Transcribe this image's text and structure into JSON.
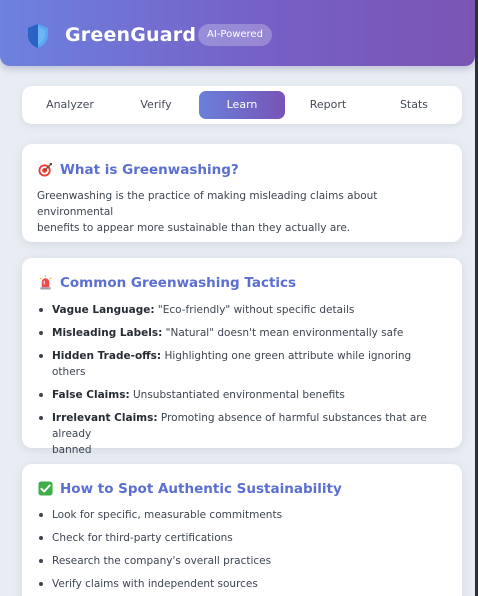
{
  "app": {
    "name": "GreenGuard",
    "badge": "AI-Powered",
    "logo_icon": "shield-icon"
  },
  "tabs": [
    {
      "label": "Analyzer",
      "active": false
    },
    {
      "label": "Verify",
      "active": false
    },
    {
      "label": "Learn",
      "active": true
    },
    {
      "label": "Report",
      "active": false
    },
    {
      "label": "Stats",
      "active": false
    }
  ],
  "sections": {
    "what": {
      "icon": "target-icon",
      "title": "What is Greenwashing?",
      "text_line1": "Greenwashing is the practice of making misleading claims about environmental",
      "text_line2": "benefits to appear more sustainable than they actually are."
    },
    "tactics": {
      "icon": "siren-icon",
      "title": "Common Greenwashing Tactics",
      "items": [
        {
          "term": "Vague Language:",
          "desc": " \"Eco-friendly\" without specific details"
        },
        {
          "term": "Misleading Labels:",
          "desc": " \"Natural\" doesn't mean environmentally safe"
        },
        {
          "term": "Hidden Trade-offs:",
          "desc": " Highlighting one green attribute while ignoring others"
        },
        {
          "term": "False Claims:",
          "desc": " Unsubstantiated environmental benefits"
        },
        {
          "term": "Irrelevant Claims:",
          "desc": " Promoting absence of harmful substances that are already",
          "desc2": "banned"
        }
      ]
    },
    "spot": {
      "icon": "check-mark-icon",
      "title": "How to Spot Authentic Sustainability",
      "items": [
        "Look for specific, measurable commitments",
        "Check for third-party certifications",
        "Research the company's overall practices",
        "Verify claims with independent sources"
      ]
    }
  },
  "colors": {
    "accent_start": "#6a80da",
    "accent_end": "#7754b6",
    "title_color": "#5b6fd1",
    "page_bg": "#e9edf3"
  }
}
